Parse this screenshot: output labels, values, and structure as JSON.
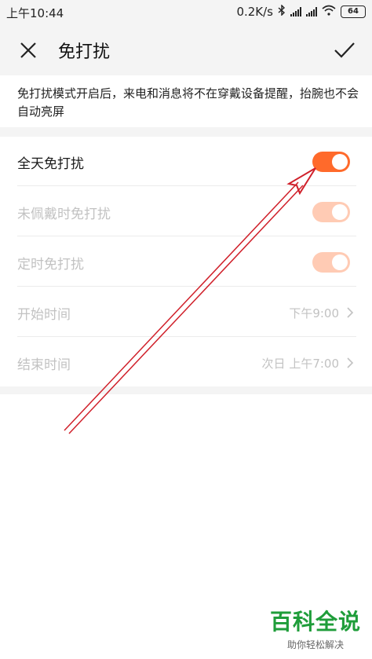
{
  "status_bar": {
    "time": "上午10:44",
    "network_speed": "0.2K/s",
    "battery": "64"
  },
  "app_bar": {
    "title": "免打扰",
    "close_icon": "close-icon",
    "confirm_icon": "check-icon"
  },
  "description": "免打扰模式开启后，来电和消息将不在穿戴设备提醒，抬腕也不会自动亮屏",
  "settings": [
    {
      "label": "全天免打扰",
      "type": "toggle",
      "on": true,
      "enabled": true
    },
    {
      "label": "未佩戴时免打扰",
      "type": "toggle",
      "on": true,
      "enabled": false
    },
    {
      "label": "定时免打扰",
      "type": "toggle",
      "on": true,
      "enabled": false
    },
    {
      "label": "开始时间",
      "type": "value",
      "value": "下午9:00",
      "enabled": false
    },
    {
      "label": "结束时间",
      "type": "value",
      "value": "次日 上午7:00",
      "enabled": false
    }
  ],
  "colors": {
    "accent": "#ff6a2b",
    "accent_disabled": "#ffcbb4",
    "annotation_arrow": "#d0202a"
  },
  "watermark": {
    "title": "百科全说",
    "subtitle": "助你轻松解决"
  }
}
